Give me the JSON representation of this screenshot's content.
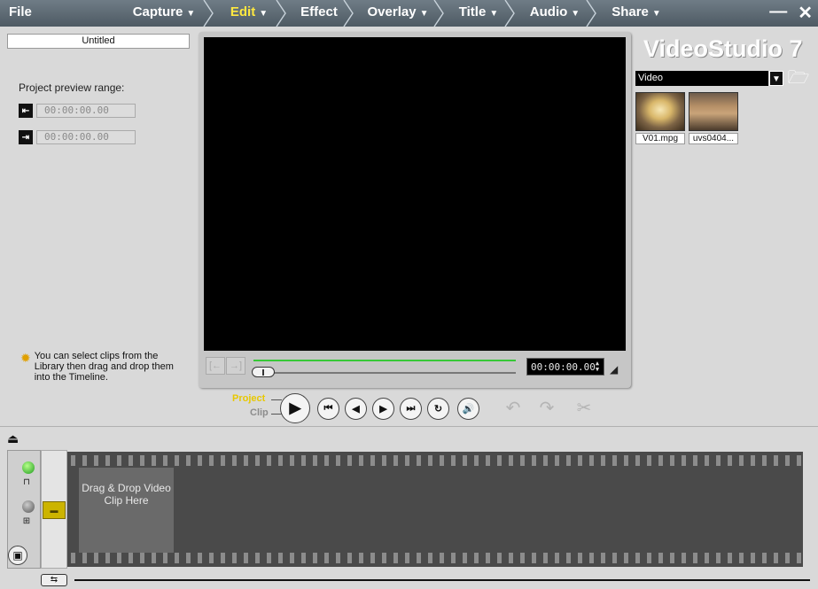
{
  "menu": {
    "file": "File",
    "steps": [
      "Capture",
      "Edit",
      "Effect",
      "Overlay",
      "Title",
      "Audio",
      "Share"
    ],
    "active_step": "Edit",
    "minimize": "—",
    "close": "✕"
  },
  "options": {
    "title_field": "Untitled",
    "range_label": "Project preview range:",
    "mark_in": "00:00:00.00",
    "mark_out": "00:00:00.00",
    "tip_text": "You can select clips from the Library then drag and drop them into the Timeline."
  },
  "preview": {
    "timecode": "00:00:00.00"
  },
  "playback": {
    "project_label": "Project",
    "clip_label": "Clip"
  },
  "library": {
    "brand": "VideoStudio 7",
    "category": "Video",
    "clips": [
      "V01.mpg",
      "uvs0404..."
    ]
  },
  "timeline": {
    "drop_zone": "Drag & Drop Video Clip Here"
  },
  "icons": {
    "file_caret": "triangle-down",
    "play": "play-icon",
    "open": "folder-open-icon"
  },
  "colors": {
    "menubar": "#5d6a74",
    "active_step": "#ffe840",
    "trim_bar": "#37c837",
    "project_label": "#e8c800"
  }
}
